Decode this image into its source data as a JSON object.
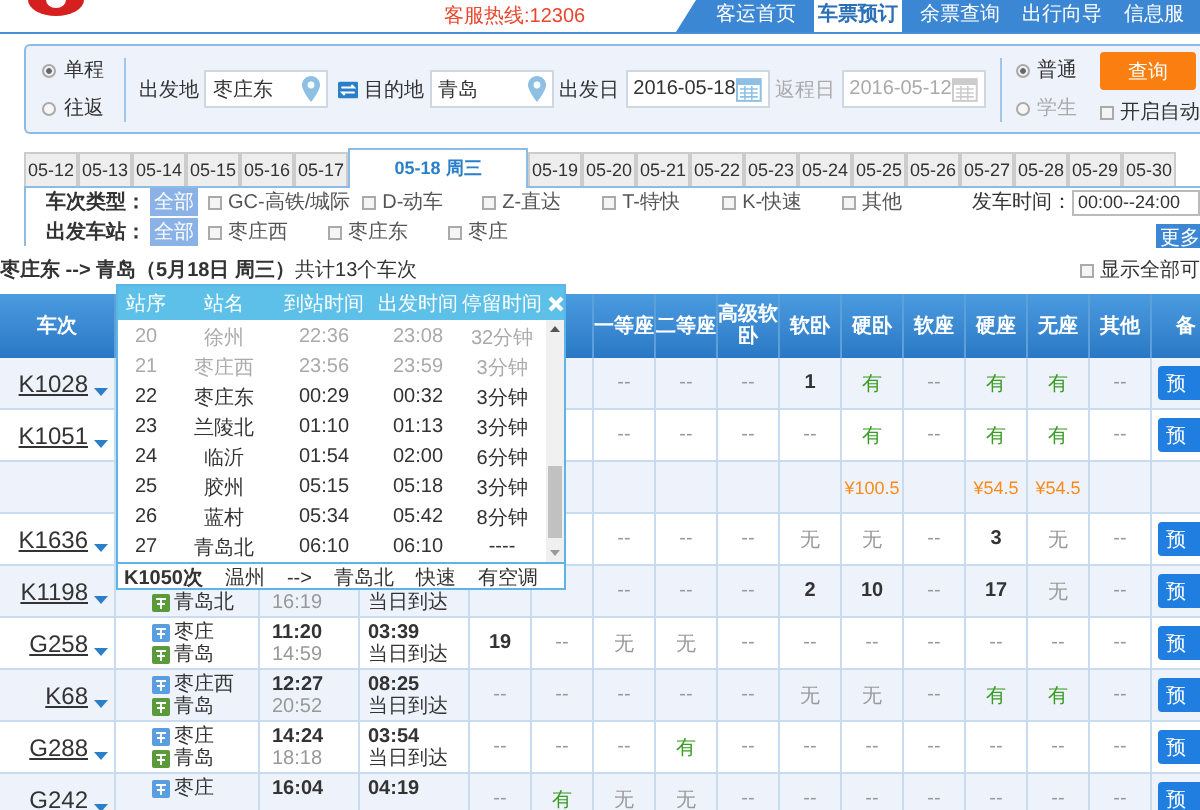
{
  "header": {
    "hotline": "客服热线:12306",
    "nav": [
      {
        "label": "客运首页",
        "selected": false
      },
      {
        "label": "车票预订",
        "selected": true
      },
      {
        "label": "余票查询",
        "selected": false
      },
      {
        "label": "出行向导",
        "selected": false
      },
      {
        "label": "信息服",
        "selected": false
      }
    ]
  },
  "search": {
    "trip_types": [
      {
        "label": "单程",
        "selected": true
      },
      {
        "label": "往返",
        "selected": false
      }
    ],
    "fields": [
      {
        "label": "出发地",
        "value": "枣庄东",
        "kind": "place",
        "disabled": false
      },
      {
        "label": "目的地",
        "value": "青岛",
        "kind": "place",
        "disabled": false
      },
      {
        "label": "出发日",
        "value": "2016-05-18",
        "kind": "date",
        "disabled": false
      },
      {
        "label": "返程日",
        "value": "2016-05-12",
        "kind": "date",
        "disabled": true
      }
    ],
    "passenger_types": [
      {
        "label": "普通",
        "selected": true,
        "disabled": false
      },
      {
        "label": "学生",
        "selected": false,
        "disabled": true
      }
    ],
    "query_button": "查询",
    "auto_query": {
      "label": "开启自动",
      "checked": false
    }
  },
  "dates": [
    {
      "label": "05-12",
      "selected": false
    },
    {
      "label": "05-13",
      "selected": false
    },
    {
      "label": "05-14",
      "selected": false
    },
    {
      "label": "05-15",
      "selected": false
    },
    {
      "label": "05-16",
      "selected": false
    },
    {
      "label": "05-17",
      "selected": false
    },
    {
      "label": "05-18 周三",
      "selected": true
    },
    {
      "label": "05-19",
      "selected": false
    },
    {
      "label": "05-20",
      "selected": false
    },
    {
      "label": "05-21",
      "selected": false
    },
    {
      "label": "05-22",
      "selected": false
    },
    {
      "label": "05-23",
      "selected": false
    },
    {
      "label": "05-24",
      "selected": false
    },
    {
      "label": "05-25",
      "selected": false
    },
    {
      "label": "05-26",
      "selected": false
    },
    {
      "label": "05-27",
      "selected": false
    },
    {
      "label": "05-28",
      "selected": false
    },
    {
      "label": "05-29",
      "selected": false
    },
    {
      "label": "05-30",
      "selected": false
    }
  ],
  "filters": {
    "train_type": {
      "label": "车次类型：",
      "all": {
        "label": "全部",
        "selected": true
      },
      "options": [
        {
          "label": "GC-高铁/城际",
          "checked": false
        },
        {
          "label": "D-动车",
          "checked": false
        },
        {
          "label": "Z-直达",
          "checked": false
        },
        {
          "label": "T-特快",
          "checked": false
        },
        {
          "label": "K-快速",
          "checked": false
        },
        {
          "label": "其他",
          "checked": false
        }
      ]
    },
    "station": {
      "label": "出发车站：",
      "all": {
        "label": "全部",
        "selected": true
      },
      "options": [
        {
          "label": "枣庄西",
          "checked": false
        },
        {
          "label": "枣庄东",
          "checked": false
        },
        {
          "label": "枣庄",
          "checked": false
        }
      ]
    },
    "time": {
      "label": "发车时间：",
      "value": "00:00--24:00"
    },
    "more_button": "更多"
  },
  "summary": {
    "text": "**枣庄东 --> 青岛（5月18日 周三）**共计13个车次",
    "show_all": {
      "label": "显示全部可",
      "checked": false
    }
  },
  "table": {
    "header_first": "车次",
    "header_seats": [
      "一等座",
      "二等座",
      "高级软卧",
      "软卧",
      "硬卧",
      "软座",
      "硬座",
      "无座",
      "其他"
    ],
    "header_last": "备",
    "rows": [
      {
        "kind": "train",
        "train": "K1028",
        "button": "预",
        "seats": [
          {
            "text": "--",
            "kind": "none"
          },
          {
            "text": "--",
            "kind": "none"
          },
          {
            "text": "--",
            "kind": "none"
          },
          {
            "text": "1",
            "kind": "count"
          },
          {
            "text": "有",
            "kind": "yes"
          },
          {
            "text": "--",
            "kind": "none"
          },
          {
            "text": "有",
            "kind": "yes"
          },
          {
            "text": "有",
            "kind": "yes"
          },
          {
            "text": "--",
            "kind": "none"
          }
        ]
      },
      {
        "kind": "train",
        "train": "K1051",
        "button": "预",
        "seats": [
          {
            "text": "--",
            "kind": "none"
          },
          {
            "text": "--",
            "kind": "none"
          },
          {
            "text": "--",
            "kind": "none"
          },
          {
            "text": "--",
            "kind": "none"
          },
          {
            "text": "有",
            "kind": "yes"
          },
          {
            "text": "--",
            "kind": "none"
          },
          {
            "text": "有",
            "kind": "yes"
          },
          {
            "text": "有",
            "kind": "yes"
          },
          {
            "text": "--",
            "kind": "none"
          }
        ]
      },
      {
        "kind": "price",
        "prices": {
          "hard_sleeper": "¥100.5",
          "hard_seat": "¥54.5",
          "no_seat": "¥54.5"
        }
      },
      {
        "kind": "train",
        "train": "K1636",
        "button": "预",
        "seats": [
          {
            "text": "--",
            "kind": "none"
          },
          {
            "text": "--",
            "kind": "none"
          },
          {
            "text": "--",
            "kind": "none"
          },
          {
            "text": "无",
            "kind": "none"
          },
          {
            "text": "无",
            "kind": "none"
          },
          {
            "text": "--",
            "kind": "none"
          },
          {
            "text": "3",
            "kind": "count"
          },
          {
            "text": "无",
            "kind": "none"
          },
          {
            "text": "--",
            "kind": "none"
          }
        ]
      },
      {
        "kind": "train",
        "train": "K1198",
        "button": "预",
        "to": "青岛北",
        "arrive": "16:19",
        "note": "当日到达",
        "seats": [
          {
            "text": "--",
            "kind": "none"
          },
          {
            "text": "--",
            "kind": "none"
          },
          {
            "text": "--",
            "kind": "none"
          },
          {
            "text": "2",
            "kind": "count"
          },
          {
            "text": "10",
            "kind": "count"
          },
          {
            "text": "--",
            "kind": "none"
          },
          {
            "text": "17",
            "kind": "count"
          },
          {
            "text": "无",
            "kind": "none"
          },
          {
            "text": "--",
            "kind": "none"
          }
        ]
      },
      {
        "kind": "train",
        "train": "G258",
        "button": "预",
        "from": "枣庄",
        "to": "青岛",
        "depart": "11:20",
        "arrive": "14:59",
        "duration": "03:39",
        "note": "当日到达",
        "seats_left": [
          {
            "text": "19",
            "kind": "count"
          },
          {
            "text": "--",
            "kind": "none"
          }
        ],
        "seats": [
          {
            "text": "无",
            "kind": "none"
          },
          {
            "text": "无",
            "kind": "none"
          },
          {
            "text": "--",
            "kind": "none"
          },
          {
            "text": "--",
            "kind": "none"
          },
          {
            "text": "--",
            "kind": "none"
          },
          {
            "text": "--",
            "kind": "none"
          },
          {
            "text": "--",
            "kind": "none"
          },
          {
            "text": "--",
            "kind": "none"
          },
          {
            "text": "--",
            "kind": "none"
          }
        ]
      },
      {
        "kind": "train",
        "train": "K68",
        "button": "预",
        "from": "枣庄西",
        "to": "青岛",
        "depart": "12:27",
        "arrive": "20:52",
        "duration": "08:25",
        "note": "当日到达",
        "seats_left": [
          {
            "text": "--",
            "kind": "none"
          },
          {
            "text": "--",
            "kind": "none"
          }
        ],
        "seats": [
          {
            "text": "--",
            "kind": "none"
          },
          {
            "text": "--",
            "kind": "none"
          },
          {
            "text": "--",
            "kind": "none"
          },
          {
            "text": "无",
            "kind": "none"
          },
          {
            "text": "无",
            "kind": "none"
          },
          {
            "text": "--",
            "kind": "none"
          },
          {
            "text": "有",
            "kind": "yes"
          },
          {
            "text": "有",
            "kind": "yes"
          },
          {
            "text": "--",
            "kind": "none"
          }
        ]
      },
      {
        "kind": "train",
        "train": "G288",
        "button": "预",
        "from": "枣庄",
        "to": "青岛",
        "depart": "14:24",
        "arrive": "18:18",
        "duration": "03:54",
        "note": "当日到达",
        "seats_left": [
          {
            "text": "--",
            "kind": "none"
          },
          {
            "text": "--",
            "kind": "none"
          }
        ],
        "seats": [
          {
            "text": "--",
            "kind": "none"
          },
          {
            "text": "有",
            "kind": "yes"
          },
          {
            "text": "--",
            "kind": "none"
          },
          {
            "text": "--",
            "kind": "none"
          },
          {
            "text": "--",
            "kind": "none"
          },
          {
            "text": "--",
            "kind": "none"
          },
          {
            "text": "--",
            "kind": "none"
          },
          {
            "text": "--",
            "kind": "none"
          },
          {
            "text": "--",
            "kind": "none"
          }
        ]
      },
      {
        "kind": "train",
        "train": "G242",
        "button": "预",
        "from": "枣庄",
        "depart": "16:04",
        "duration": "04:19",
        "seats_left": [
          {
            "text": "--",
            "kind": "none"
          },
          {
            "text": "有",
            "kind": "yes"
          }
        ],
        "seats": [
          {
            "text": "无",
            "kind": "none"
          },
          {
            "text": "无",
            "kind": "none"
          },
          {
            "text": "--",
            "kind": "none"
          },
          {
            "text": "--",
            "kind": "none"
          },
          {
            "text": "--",
            "kind": "none"
          },
          {
            "text": "--",
            "kind": "none"
          },
          {
            "text": "--",
            "kind": "none"
          },
          {
            "text": "--",
            "kind": "none"
          },
          {
            "text": "--",
            "kind": "none"
          }
        ]
      }
    ]
  },
  "stops_popup": {
    "columns": [
      "站序",
      "站名",
      "到站时间",
      "出发时间",
      "停留时间"
    ],
    "stops": [
      {
        "no": "20",
        "station": "徐州",
        "arrive": "22:36",
        "depart": "23:08",
        "stop": "32分钟",
        "passed": true
      },
      {
        "no": "21",
        "station": "枣庄西",
        "arrive": "23:56",
        "depart": "23:59",
        "stop": "3分钟",
        "passed": true
      },
      {
        "no": "22",
        "station": "枣庄东",
        "arrive": "00:29",
        "depart": "00:32",
        "stop": "3分钟",
        "passed": false
      },
      {
        "no": "23",
        "station": "兰陵北",
        "arrive": "01:10",
        "depart": "01:13",
        "stop": "3分钟",
        "passed": false
      },
      {
        "no": "24",
        "station": "临沂",
        "arrive": "01:54",
        "depart": "02:00",
        "stop": "6分钟",
        "passed": false
      },
      {
        "no": "25",
        "station": "胶州",
        "arrive": "05:15",
        "depart": "05:18",
        "stop": "3分钟",
        "passed": false
      },
      {
        "no": "26",
        "station": "蓝村",
        "arrive": "05:34",
        "depart": "05:42",
        "stop": "8分钟",
        "passed": false
      },
      {
        "no": "27",
        "station": "青岛北",
        "arrive": "06:10",
        "depart": "06:10",
        "stop": "----",
        "passed": false
      }
    ],
    "footer": {
      "train": "K1050次",
      "from": "温州",
      "arrow": "-->",
      "to": "青岛北",
      "type": "快速",
      "ac": "有空调"
    }
  }
}
